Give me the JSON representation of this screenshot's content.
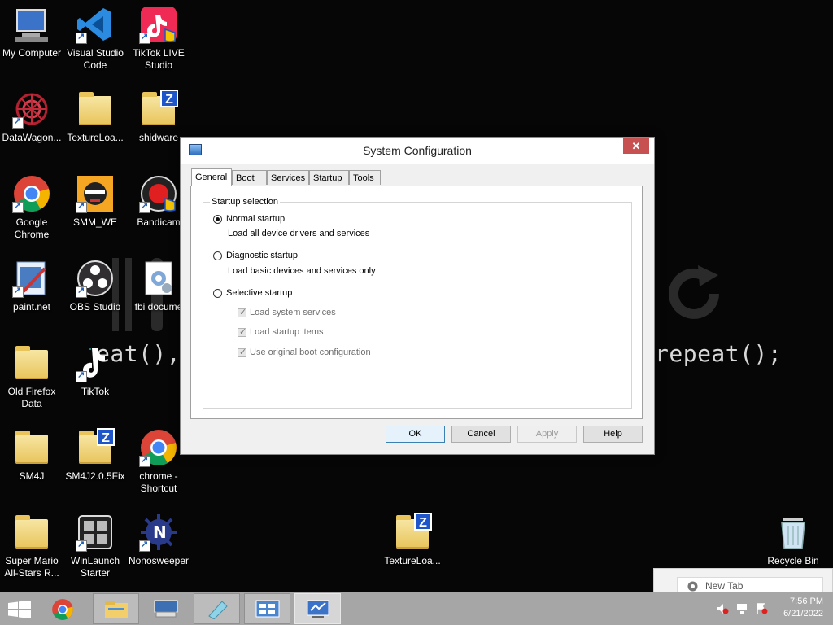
{
  "wallpaper": {
    "left_code": "eat()",
    "left_code_suffix": ",",
    "right_code": "repeat();"
  },
  "desktop_icons": [
    {
      "label": "My Computer",
      "icon": "computer-icon"
    },
    {
      "label": "Visual Studio Code",
      "icon": "vscode-icon"
    },
    {
      "label": "TikTok LIVE Studio",
      "icon": "tiktok-live-icon"
    },
    {
      "label": "DataWagon...",
      "icon": "datawagon-icon"
    },
    {
      "label": "TextureLoa...",
      "icon": "folder-icon"
    },
    {
      "label": "shidware",
      "icon": "folder-zip-icon"
    },
    {
      "label": "Google Chrome",
      "icon": "chrome-icon"
    },
    {
      "label": "SMM_WE",
      "icon": "smm-we-icon"
    },
    {
      "label": "Bandicam",
      "icon": "bandicam-icon"
    },
    {
      "label": "paint.net",
      "icon": "paintnet-icon"
    },
    {
      "label": "OBS Studio",
      "icon": "obs-icon"
    },
    {
      "label": "fbi docume",
      "icon": "document-gear-icon"
    },
    {
      "label": "Old Firefox Data",
      "icon": "folder-icon"
    },
    {
      "label": "TikTok",
      "icon": "tiktok-icon"
    },
    {
      "label": "SM4J",
      "icon": "folder-icon"
    },
    {
      "label": "SM4J2.0.5Fix",
      "icon": "folder-zip-icon"
    },
    {
      "label": "chrome - Shortcut",
      "icon": "chrome-icon"
    },
    {
      "label": "Super Mario All-Stars R...",
      "icon": "folder-icon"
    },
    {
      "label": "WinLaunch Starter",
      "icon": "winlaunch-icon"
    },
    {
      "label": "Nonosweeper",
      "icon": "nonosweeper-icon"
    },
    {
      "label": "TextureLoa...",
      "icon": "folder-zip-icon"
    },
    {
      "label": "Recycle Bin",
      "icon": "recycle-bin-icon"
    }
  ],
  "dialog": {
    "title": "System Configuration",
    "close": "✕",
    "tabs": [
      "General",
      "Boot",
      "Services",
      "Startup",
      "Tools"
    ],
    "active_tab": "General",
    "group_label": "Startup selection",
    "normal_label": "Normal startup",
    "normal_desc": "Load all device drivers and services",
    "diagnostic_label": "Diagnostic startup",
    "diagnostic_desc": "Load basic devices and services only",
    "selective_label": "Selective startup",
    "selected_option": "Normal startup",
    "checks": [
      {
        "label": "Load system services",
        "checked": true,
        "enabled": false
      },
      {
        "label": "Load startup items",
        "checked": true,
        "enabled": false
      },
      {
        "label": "Use original boot configuration",
        "checked": true,
        "enabled": false
      }
    ],
    "buttons": {
      "ok": "OK",
      "cancel": "Cancel",
      "apply": "Apply",
      "help": "Help"
    }
  },
  "taskbar": {
    "items": [
      "windows-start",
      "chrome",
      "file-explorer",
      "keyboard-settings",
      "paint",
      "control-panel",
      "system-configuration"
    ],
    "active_item": "system-configuration",
    "time": "7:56 PM",
    "date": "6/21/2022"
  },
  "chrome_popup": {
    "tab_label": "New Tab"
  },
  "colors": {
    "desktop_bg": "#060606",
    "taskbar_bg": "#a6a6a6",
    "close_button": "#c75050",
    "default_button_border": "#3c7fb1"
  }
}
